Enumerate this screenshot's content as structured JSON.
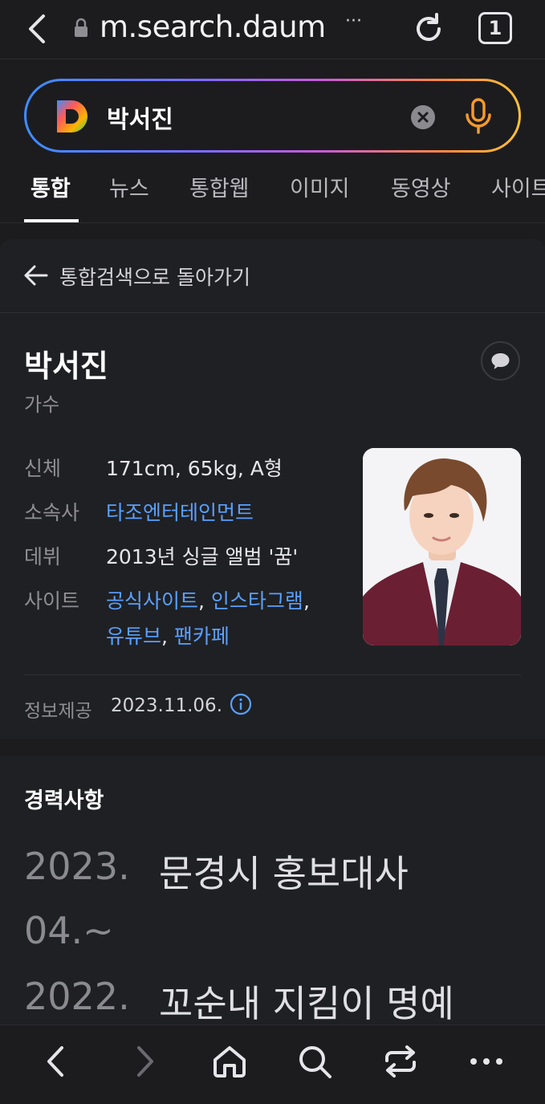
{
  "browser": {
    "url": "m.search.daum",
    "more_label": "···",
    "tab_count": "1"
  },
  "search": {
    "query": "박서진",
    "tabs": [
      {
        "label": "통합",
        "active": true
      },
      {
        "label": "뉴스"
      },
      {
        "label": "통합웹"
      },
      {
        "label": "이미지"
      },
      {
        "label": "동영상"
      },
      {
        "label": "사이트"
      }
    ]
  },
  "profile": {
    "back_label": "통합검색으로 돌아가기",
    "name": "박서진",
    "job": "가수",
    "info": {
      "body_label": "신체",
      "body_value": "171cm, 65kg, A형",
      "agency_label": "소속사",
      "agency_value": "타조엔터테인먼트",
      "debut_label": "데뷔",
      "debut_value": "2013년 싱글 앨범 '꿈'",
      "site_label": "사이트",
      "sites": [
        "공식사이트",
        "인스타그램",
        "유튜브",
        "팬카페"
      ]
    },
    "provider_label": "정보제공",
    "provider_date": "2023.11.06."
  },
  "career": {
    "title": "경력사항",
    "items": [
      {
        "year": "2023.",
        "year2": "04.~",
        "desc": "문경시 홍보대사"
      },
      {
        "year": "2022.",
        "desc": "꼬순내 지킴이 명예"
      }
    ]
  },
  "colors": {
    "background": "#1c1c1f",
    "card": "#1f2023",
    "link": "#5aa0ff",
    "mic": "#f59a2a"
  },
  "icons": {
    "back": "chevron-left-icon",
    "lock": "lock-icon",
    "reload": "reload-icon",
    "clear": "clear-icon",
    "mic": "microphone-icon",
    "feedback": "speech-bubble-icon",
    "info": "info-icon",
    "nav": [
      "chevron-left-icon",
      "chevron-right-icon",
      "home-icon",
      "search-icon",
      "switch-icon",
      "more-icon"
    ]
  }
}
